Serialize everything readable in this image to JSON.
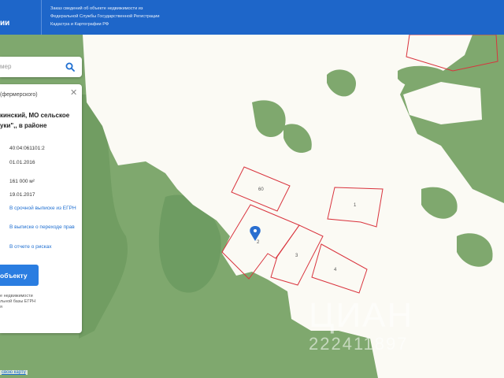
{
  "header": {
    "logo_fragment": "ии",
    "notice": "Заказ сведений об объекте недвижимости из Федеральной Службы Государственной Регистрации Кадастра и Картографии РФ"
  },
  "search": {
    "placeholder_fragment": "мер"
  },
  "panel": {
    "type_fragment": "(фермерского)",
    "address_line1": "кинский, МО сельское",
    "address_line2": "уки\",, в районе",
    "cadastral_number": "40:04:061101:2",
    "date1": "01.01.2016",
    "area": "161 000 м²",
    "date2": "19.01.2017",
    "link_urgent": "В срочной выписке из ЕГРН",
    "link_transfer": "В выписке о переходе прав",
    "link_risks": "В отчете о рисках",
    "order_button": "объекту",
    "note_line1": "е недвижимости",
    "note_line2": "льной базы ЕГРН",
    "note_line3": "я"
  },
  "bottom_link": "свою карту",
  "map": {
    "parcel_labels": [
      "60",
      "1",
      "2",
      "3",
      "4"
    ]
  },
  "watermark": {
    "line1": "ЦИАН",
    "line2": "222411897"
  },
  "colors": {
    "header": "#1e66c9",
    "forest": "#7fa86e",
    "field": "#fbfaf4",
    "parcel_border": "#d9333d",
    "button": "#2a7de1"
  }
}
